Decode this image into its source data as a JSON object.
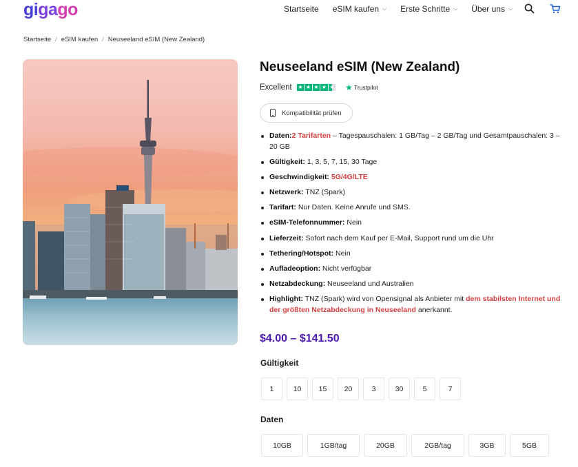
{
  "header": {
    "logo": "gigago",
    "nav": [
      {
        "label": "Startseite",
        "dropdown": false
      },
      {
        "label": "eSIM kaufen",
        "dropdown": true
      },
      {
        "label": "Erste Schritte",
        "dropdown": true
      },
      {
        "label": "Über uns",
        "dropdown": true
      }
    ],
    "search_icon": "search-icon",
    "cart_icon": "cart-icon"
  },
  "breadcrumb": [
    "Startseite",
    "eSIM kaufen",
    "Neuseeland eSIM (New Zealand)"
  ],
  "product": {
    "title": "Neuseeland eSIM (New Zealand)",
    "rating_text": "Excellent",
    "rating_stars": 4.5,
    "trustpilot": "Trustpilot",
    "compat_button": "Kompatibilität prüfen",
    "features": [
      {
        "label": "Daten:",
        "parts": [
          {
            "t": "2 Tarifarten",
            "red": true
          },
          {
            "t": " – Tagespauschalen: 1 GB/Tag – 2 GB/Tag und Gesamtpauschalen: 3 – 20 GB",
            "red": false
          }
        ]
      },
      {
        "label": "Gültigkeit:",
        "parts": [
          {
            "t": " 1, 3, 5, 7, 15, 30 Tage",
            "red": false
          }
        ]
      },
      {
        "label": "Geschwindigkeit:",
        "parts": [
          {
            "t": " 5G/4G/LTE",
            "red": true
          }
        ]
      },
      {
        "label": "Netzwerk:",
        "parts": [
          {
            "t": " TNZ (Spark)",
            "red": false
          }
        ]
      },
      {
        "label": "Tarifart:",
        "parts": [
          {
            "t": " Nur Daten. Keine Anrufe und SMS.",
            "red": false
          }
        ]
      },
      {
        "label": "eSIM-Telefonnummer:",
        "parts": [
          {
            "t": " Nein",
            "red": false
          }
        ]
      },
      {
        "label": "Lieferzeit:",
        "parts": [
          {
            "t": " Sofort nach dem Kauf per E-Mail, Support rund um die Uhr",
            "red": false
          }
        ]
      },
      {
        "label": "Tethering/Hotspot:",
        "parts": [
          {
            "t": " Nein",
            "red": false
          }
        ]
      },
      {
        "label": "Aufladeoption:",
        "parts": [
          {
            "t": " Nicht verfügbar",
            "red": false
          }
        ]
      },
      {
        "label": "Netzabdeckung:",
        "parts": [
          {
            "t": " Neuseeland und Australien",
            "red": false
          }
        ]
      },
      {
        "label": "Highlight:",
        "parts": [
          {
            "t": " TNZ (Spark) wird von Opensignal als Anbieter mit ",
            "red": false
          },
          {
            "t": "dem stabilsten Internet und der größten Netzabdeckung in Neuseeland",
            "red": true
          },
          {
            "t": " anerkannt.",
            "red": false
          }
        ]
      }
    ],
    "price": "$4.00 – $141.50",
    "validity_label": "Gültigkeit",
    "validity_options": [
      "1",
      "10",
      "15",
      "20",
      "3",
      "30",
      "5",
      "7"
    ],
    "data_label": "Daten",
    "data_options": [
      "10GB",
      "1GB/tag",
      "20GB",
      "2GB/tag",
      "3GB",
      "5GB"
    ]
  },
  "colors": {
    "accent_purple": "#4b16b0",
    "highlight_red": "#d23f3f",
    "trustpilot_green": "#00b67a"
  }
}
